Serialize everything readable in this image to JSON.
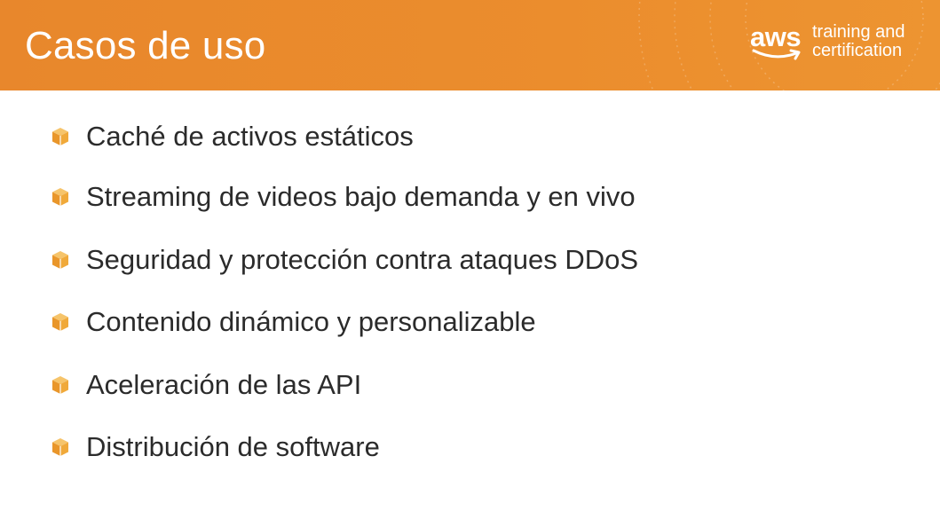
{
  "slide": {
    "title": "Casos de uso"
  },
  "logo": {
    "brand": "aws",
    "line1": "training and",
    "line2": "certification",
    "icon": "aws-smile-icon"
  },
  "bullets": [
    {
      "text": "Caché de activos estáticos",
      "icon": "cube-icon"
    },
    {
      "text": "Streaming de videos bajo demanda y en vivo",
      "icon": "cube-icon"
    },
    {
      "text": "Seguridad y protección contra ataques DDoS",
      "icon": "cube-icon"
    },
    {
      "text": "Contenido dinámico y personalizable",
      "icon": "cube-icon"
    },
    {
      "text": "Aceleración de las API",
      "icon": "cube-icon"
    },
    {
      "text": "Distribución de software",
      "icon": "cube-icon"
    }
  ],
  "colors": {
    "header": "#eb8d2d",
    "bullet_icon": "#f0a93a",
    "text": "#2b2b2b"
  }
}
